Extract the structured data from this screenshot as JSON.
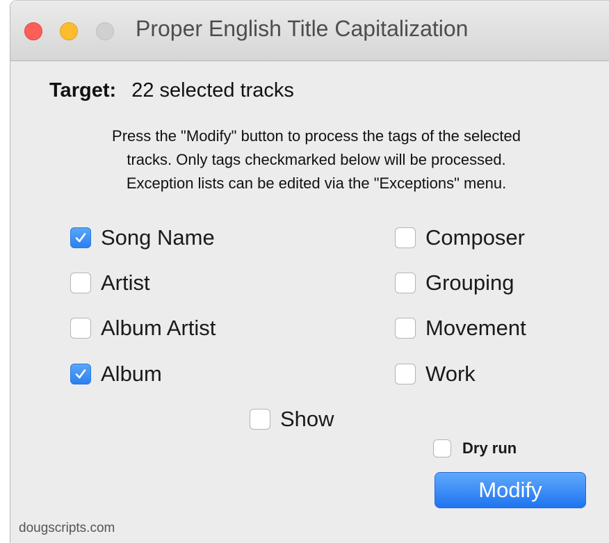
{
  "window": {
    "title": "Proper English Title Capitalization"
  },
  "target": {
    "label": "Target:",
    "value": "22 selected tracks"
  },
  "description": {
    "line1": "Press the \"Modify\" button to process the tags of the selected",
    "line2": "tracks. Only tags checkmarked below will be processed.",
    "line3": "Exception lists can be edited via the \"Exceptions\" menu."
  },
  "tags": {
    "song_name": {
      "label": "Song Name",
      "checked": true
    },
    "artist": {
      "label": "Artist",
      "checked": false
    },
    "album_artist": {
      "label": "Album Artist",
      "checked": false
    },
    "album": {
      "label": "Album",
      "checked": true
    },
    "composer": {
      "label": "Composer",
      "checked": false
    },
    "grouping": {
      "label": "Grouping",
      "checked": false
    },
    "movement": {
      "label": "Movement",
      "checked": false
    },
    "work": {
      "label": "Work",
      "checked": false
    },
    "show": {
      "label": "Show",
      "checked": false
    }
  },
  "dry_run": {
    "label": "Dry run",
    "checked": false
  },
  "modify_button": {
    "label": "Modify"
  },
  "footer": {
    "text": "dougscripts.com"
  },
  "colors": {
    "accent": "#2a7ff2",
    "close": "#fc5f57",
    "minimize": "#fdbc2e",
    "zoom_disabled": "#d0d0d0",
    "window_bg": "#ececec"
  }
}
